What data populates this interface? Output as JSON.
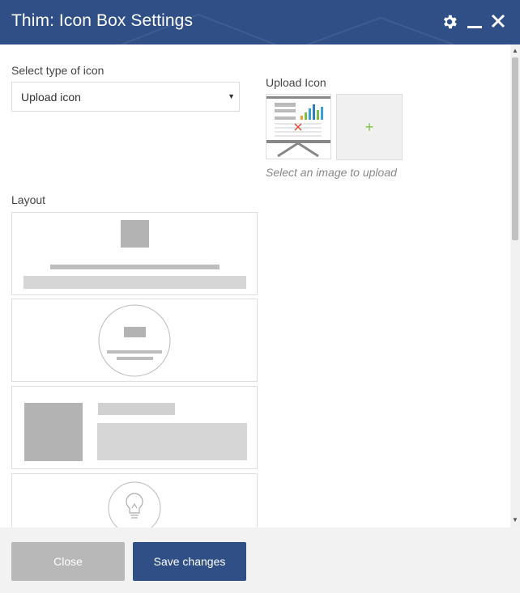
{
  "window": {
    "title": "Thim: Icon Box Settings",
    "icons": [
      "gear-icon",
      "minimize-icon",
      "close-icon"
    ]
  },
  "form": {
    "icon_type_label": "Select type of icon",
    "icon_type_value": "Upload icon",
    "upload_label": "Upload Icon",
    "upload_hint": "Select an image to upload",
    "upload_add_symbol": "+",
    "layout_label": "Layout",
    "layout_options": [
      "layout-top-icon",
      "layout-circle-icon",
      "layout-left-icon",
      "layout-bulb-circle"
    ]
  },
  "footer": {
    "close_label": "Close",
    "save_label": "Save changes"
  },
  "colors": {
    "header": "#2f4f86",
    "primary_button": "#2f4f86",
    "close_button": "#b8b8b8",
    "accent_green": "#7bc043"
  }
}
